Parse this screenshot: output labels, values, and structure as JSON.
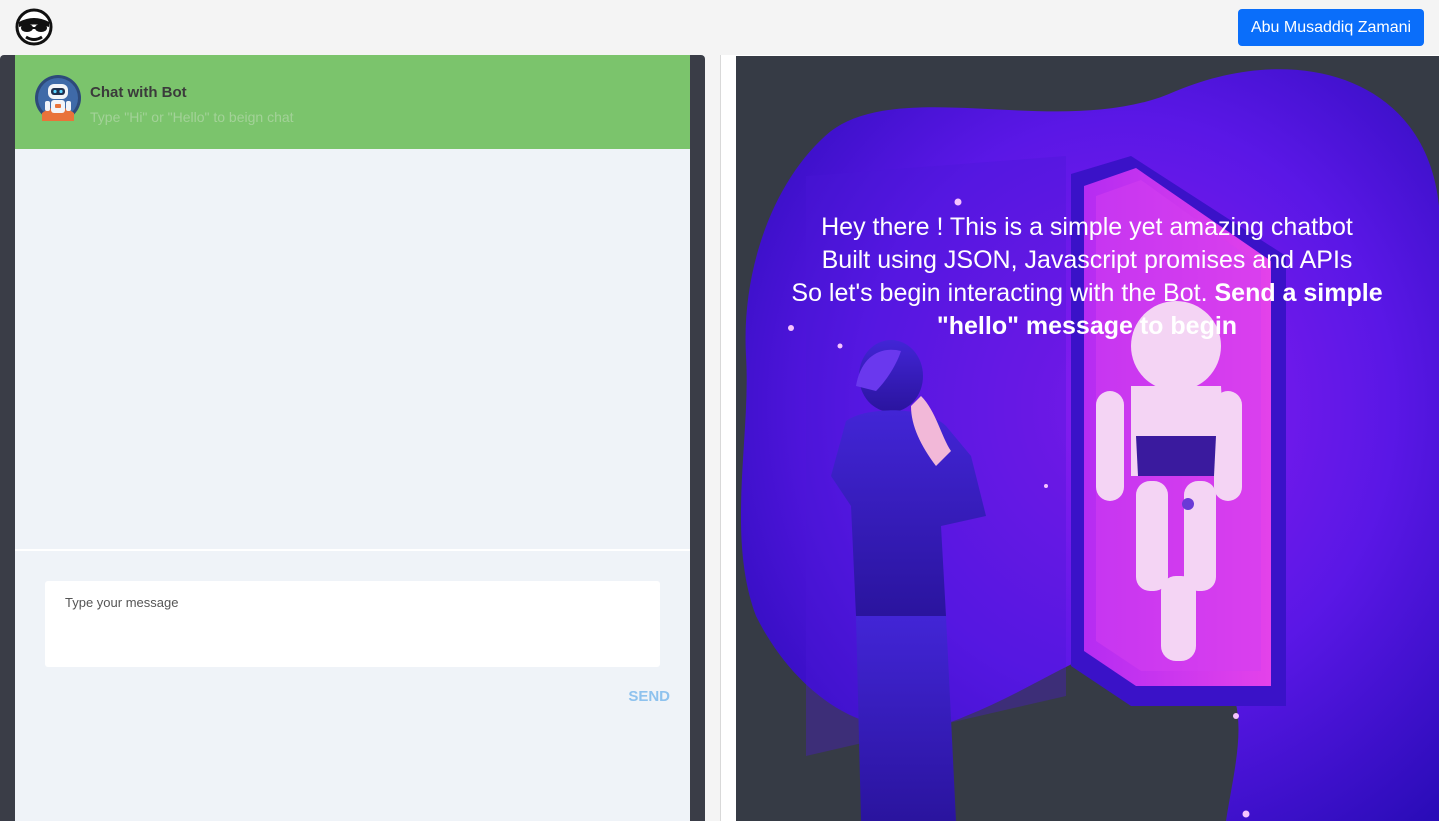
{
  "navbar": {
    "logo_icon": "masked-face-logo-icon",
    "user_button_label": "Abu Musaddiq Zamani",
    "accent_color": "#0a6efa"
  },
  "chat": {
    "header_color": "#7bc46c",
    "avatar_icon": "robot-avatar-icon",
    "title": "Chat with Bot",
    "subtitle": "Type \"Hi\" or \"Hello\" to beign chat",
    "messages": [],
    "input": {
      "placeholder": "Type your message",
      "value": ""
    },
    "send_label": "SEND"
  },
  "hero": {
    "illustration": "man-facing-robot-in-mirror-illustration",
    "line1": "Hey there ! This is a simple yet amazing chatbot",
    "line2": "Built using JSON, Javascript promises and APIs",
    "line3_plain": "So let's begin interacting with the Bot.",
    "line3_bold": "Send a simple \"hello\" message to begin"
  }
}
